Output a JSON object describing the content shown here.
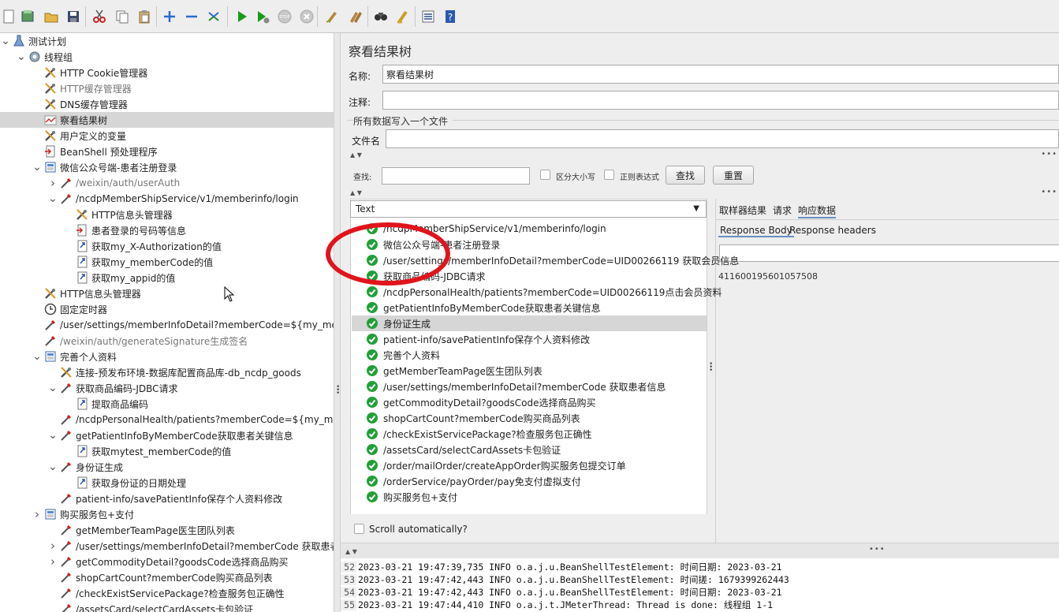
{
  "toolbar": {
    "icons": [
      "new-icon",
      "templates-icon",
      "open-icon",
      "save-icon",
      "cut-icon",
      "copy-icon",
      "paste-icon",
      "expand-icon",
      "collapse-icon",
      "toggle-icon",
      "start-icon",
      "start-no-pause-icon",
      "stop-icon",
      "shutdown-icon",
      "clear-icon",
      "clear-all-icon",
      "search-icon",
      "reset-search-icon",
      "function-helper-icon",
      "help-icon"
    ]
  },
  "tree": {
    "nodes": [
      {
        "label": "测试计划",
        "icon": "flask-icon",
        "level": 0,
        "arrow": "down",
        "disabled": false
      },
      {
        "label": "线程组",
        "icon": "gear-icon",
        "level": 1,
        "arrow": "down",
        "disabled": false
      },
      {
        "label": "HTTP Cookie管理器",
        "icon": "tools-icon",
        "level": 2,
        "arrow": "",
        "disabled": false
      },
      {
        "label": "HTTP缓存管理器",
        "icon": "tools-icon",
        "level": 2,
        "arrow": "",
        "disabled": true
      },
      {
        "label": "DNS缓存管理器",
        "icon": "tools-icon",
        "level": 2,
        "arrow": "",
        "disabled": false
      },
      {
        "label": "察看结果树",
        "icon": "graph-icon",
        "level": 2,
        "arrow": "",
        "disabled": false,
        "selected": true
      },
      {
        "label": "用户定义的变量",
        "icon": "tools-icon",
        "level": 2,
        "arrow": "",
        "disabled": false
      },
      {
        "label": "BeanShell 预处理程序",
        "icon": "preproc-icon",
        "level": 2,
        "arrow": "",
        "disabled": false
      },
      {
        "label": "微信公众号端-患者注册登录",
        "icon": "controller-icon",
        "level": 2,
        "arrow": "down",
        "disabled": false
      },
      {
        "label": "/weixin/auth/userAuth",
        "icon": "pipette-icon",
        "level": 3,
        "arrow": "right",
        "disabled": true
      },
      {
        "label": "/ncdpMemberShipService/v1/memberinfo/login",
        "icon": "pipette-icon",
        "level": 3,
        "arrow": "down",
        "disabled": false
      },
      {
        "label": "HTTP信息头管理器",
        "icon": "tools-icon",
        "level": 4,
        "arrow": "",
        "disabled": false
      },
      {
        "label": "患者登录的号码等信息",
        "icon": "preproc-icon",
        "level": 4,
        "arrow": "",
        "disabled": false
      },
      {
        "label": "获取my_X-Authorization的值",
        "icon": "postproc-icon",
        "level": 4,
        "arrow": "",
        "disabled": false
      },
      {
        "label": "获取my_memberCode的值",
        "icon": "postproc-icon",
        "level": 4,
        "arrow": "",
        "disabled": false
      },
      {
        "label": "获取my_appid的值",
        "icon": "postproc-icon",
        "level": 4,
        "arrow": "",
        "disabled": false
      },
      {
        "label": "HTTP信息头管理器",
        "icon": "tools-icon",
        "level": 2,
        "arrow": "",
        "disabled": false
      },
      {
        "label": "固定定时器",
        "icon": "timer-icon",
        "level": 2,
        "arrow": "",
        "disabled": false
      },
      {
        "label": "/user/settings/memberInfoDetail?memberCode=${my_memberC",
        "icon": "pipette-icon",
        "level": 2,
        "arrow": "",
        "disabled": false
      },
      {
        "label": "/weixin/auth/generateSignature生成签名",
        "icon": "pipette-icon",
        "level": 2,
        "arrow": "",
        "disabled": true
      },
      {
        "label": "完善个人资料",
        "icon": "controller-icon",
        "level": 2,
        "arrow": "down",
        "disabled": false
      },
      {
        "label": "连接-预发布环境-数据库配置商品库-db_ncdp_goods",
        "icon": "tools-icon",
        "level": 3,
        "arrow": "",
        "disabled": false
      },
      {
        "label": "获取商品编码-JDBC请求",
        "icon": "pipette-icon",
        "level": 3,
        "arrow": "down",
        "disabled": false
      },
      {
        "label": "提取商品编码",
        "icon": "postproc-icon",
        "level": 4,
        "arrow": "",
        "disabled": false
      },
      {
        "label": "/ncdpPersonalHealth/patients?memberCode=${my_memberC",
        "icon": "pipette-icon",
        "level": 3,
        "arrow": "",
        "disabled": false
      },
      {
        "label": "getPatientInfoByMemberCode获取患者关键信息",
        "icon": "pipette-icon",
        "level": 3,
        "arrow": "down",
        "disabled": false
      },
      {
        "label": "获取mytest_memberCode的值",
        "icon": "postproc-icon",
        "level": 4,
        "arrow": "",
        "disabled": false
      },
      {
        "label": "身份证生成",
        "icon": "pipette-icon",
        "level": 3,
        "arrow": "down",
        "disabled": false
      },
      {
        "label": "获取身份证的日期处理",
        "icon": "postproc-icon",
        "level": 4,
        "arrow": "",
        "disabled": false
      },
      {
        "label": "patient-info/savePatientInfo保存个人资料修改",
        "icon": "pipette-icon",
        "level": 3,
        "arrow": "",
        "disabled": false
      },
      {
        "label": "购买服务包+支付",
        "icon": "controller-icon",
        "level": 2,
        "arrow": "right",
        "disabled": false
      },
      {
        "label": "getMemberTeamPage医生团队列表",
        "icon": "pipette-icon",
        "level": 3,
        "arrow": "",
        "disabled": false
      },
      {
        "label": "/user/settings/memberInfoDetail?memberCode 获取患者信息",
        "icon": "pipette-icon",
        "level": 3,
        "arrow": "right",
        "disabled": false
      },
      {
        "label": "getCommodityDetail?goodsCode选择商品购买",
        "icon": "pipette-icon",
        "level": 3,
        "arrow": "right",
        "disabled": false
      },
      {
        "label": "shopCartCount?memberCode购买商品列表",
        "icon": "pipette-icon",
        "level": 3,
        "arrow": "",
        "disabled": false
      },
      {
        "label": "/checkExistServicePackage?检查服务包正确性",
        "icon": "pipette-icon",
        "level": 3,
        "arrow": "",
        "disabled": false
      },
      {
        "label": "/assetsCard/selectCardAssets卡包验证",
        "icon": "pipette-icon",
        "level": 3,
        "arrow": "",
        "disabled": false
      }
    ]
  },
  "panel": {
    "title": "察看结果树",
    "name_label": "名称:",
    "name_value": "察看结果树",
    "comment_label": "注释:",
    "comment_value": "",
    "file_group_label": "所有数据写入一个文件",
    "filename_label": "文件名",
    "filename_value": "",
    "search_label": "查找:",
    "case_sensitive_label": "区分大小写",
    "regex_label": "正则表达式",
    "find_button": "查找",
    "reset_button": "重置"
  },
  "results": {
    "renderer": "Text",
    "scroll_auto_label": "Scroll automatically?",
    "items": [
      "/ncdpMemberShipService/v1/memberinfo/login",
      "微信公众号端-患者注册登录",
      "/user/settings/memberInfoDetail?memberCode=UID00266119 获取会员信息",
      "获取商品编码-JDBC请求",
      "/ncdpPersonalHealth/patients?memberCode=UID00266119点击会员资料",
      "getPatientInfoByMemberCode获取患者关键信息",
      "身份证生成",
      "patient-info/savePatientInfo保存个人资料修改",
      "完善个人资料",
      "getMemberTeamPage医生团队列表",
      "/user/settings/memberInfoDetail?memberCode 获取患者信息",
      "getCommodityDetail?goodsCode选择商品购买",
      "shopCartCount?memberCode购买商品列表",
      "/checkExistServicePackage?检查服务包正确性",
      "/assetsCard/selectCardAssets卡包验证",
      "/order/mailOrder/createAppOrder购买服务包提交订单",
      "/orderService/payOrder/pay免支付虚拟支付",
      "购买服务包+支付"
    ],
    "selected_index": 6
  },
  "detail": {
    "tabs": [
      "取样器结果",
      "请求",
      "响应数据"
    ],
    "active_tab": "响应数据",
    "subtabs": [
      "Response Body",
      "Response headers"
    ],
    "response_body": "411600195601057508"
  },
  "log": {
    "lines": [
      {
        "num": "52",
        "text": "2023-03-21 19:47:39,735 INFO o.a.j.u.BeanShellTestElement: 时间日期: 2023-03-21"
      },
      {
        "num": "53",
        "text": "2023-03-21 19:47:42,443 INFO o.a.j.u.BeanShellTestElement: 时间搓: 1679399262443"
      },
      {
        "num": "54",
        "text": "2023-03-21 19:47:42,443 INFO o.a.j.u.BeanShellTestElement: 时间日期: 2023-03-21"
      },
      {
        "num": "55",
        "text": "2023-03-21 19:47:44,410 INFO o.a.j.t.JMeterThread: Thread is done: 线程组 1-1"
      }
    ]
  }
}
